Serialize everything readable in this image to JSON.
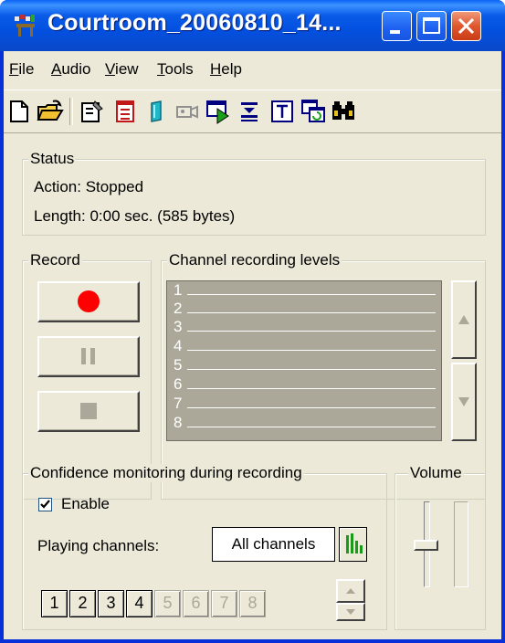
{
  "window": {
    "title": "Courtroom_20060810_14..."
  },
  "menu": [
    {
      "label": "File",
      "accel": "F",
      "rest": "ile"
    },
    {
      "label": "Audio",
      "accel": "A",
      "rest": "udio"
    },
    {
      "label": "View",
      "accel": "V",
      "rest": "iew"
    },
    {
      "label": "Tools",
      "accel": "T",
      "rest": "ools"
    },
    {
      "label": "Help",
      "accel": "H",
      "rest": "elp"
    }
  ],
  "toolbar_icons": [
    "new-document-icon",
    "open-folder-icon",
    "properties-icon",
    "notes-icon",
    "marker-icon",
    "camera-icon",
    "play-window-icon",
    "download-icon",
    "text-icon",
    "restore-icon",
    "find-icon"
  ],
  "status": {
    "title": "Status",
    "action_label": "Action:",
    "action_value": "Stopped",
    "length_label": "Length:",
    "length_value": "0:00 sec. (585 bytes)"
  },
  "record": {
    "title": "Record"
  },
  "levels": {
    "title": "Channel recording levels",
    "channels": [
      "1",
      "2",
      "3",
      "4",
      "5",
      "6",
      "7",
      "8"
    ]
  },
  "monitoring": {
    "title": "Confidence monitoring during recording",
    "enable_label": "Enable",
    "enable_checked": true,
    "playing_label": "Playing channels:",
    "playing_value": "All channels",
    "channel_buttons": [
      {
        "label": "1",
        "enabled": true
      },
      {
        "label": "2",
        "enabled": true
      },
      {
        "label": "3",
        "enabled": true
      },
      {
        "label": "4",
        "enabled": true
      },
      {
        "label": "5",
        "enabled": false
      },
      {
        "label": "6",
        "enabled": false
      },
      {
        "label": "7",
        "enabled": false
      },
      {
        "label": "8",
        "enabled": false
      }
    ]
  },
  "volume": {
    "title": "Volume"
  },
  "colors": {
    "record": "#ff0000",
    "accent_green": "#1a9a1a",
    "title_blue": "#0a5be8"
  }
}
